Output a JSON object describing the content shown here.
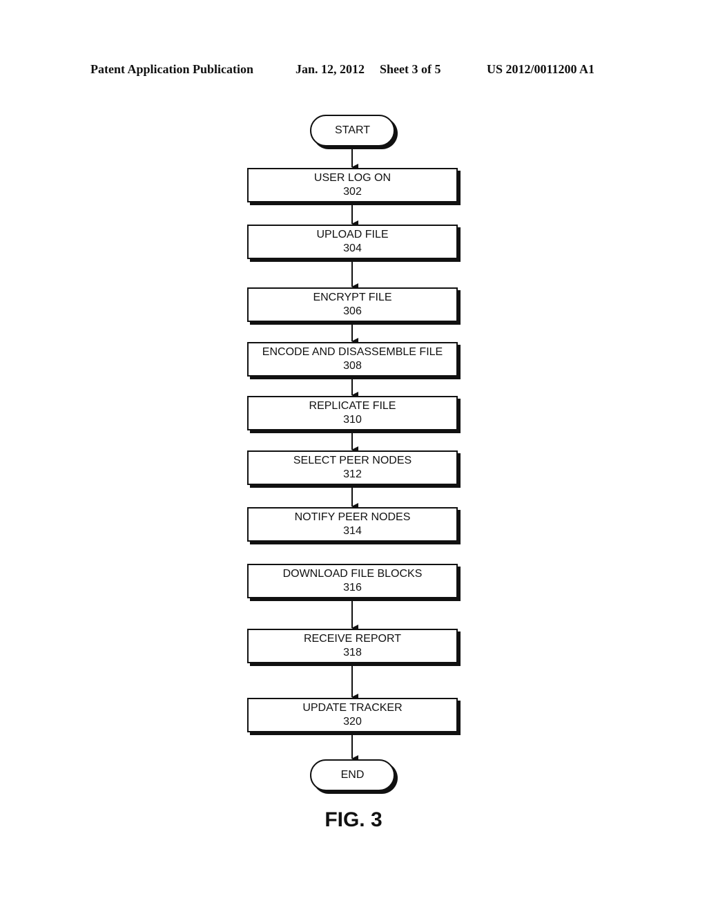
{
  "header": {
    "publication": "Patent Application Publication",
    "date": "Jan. 12, 2012",
    "sheet": "Sheet 3 of 5",
    "number": "US 2012/0011200 A1"
  },
  "flowchart": {
    "start": "START",
    "end": "END",
    "steps": [
      {
        "label": "USER LOG ON",
        "ref": "302"
      },
      {
        "label": "UPLOAD FILE",
        "ref": "304"
      },
      {
        "label": "ENCRYPT FILE",
        "ref": "306"
      },
      {
        "label": "ENCODE AND DISASSEMBLE FILE",
        "ref": "308"
      },
      {
        "label": "REPLICATE FILE",
        "ref": "310"
      },
      {
        "label": "SELECT PEER NODES",
        "ref": "312"
      },
      {
        "label": "NOTIFY PEER NODES",
        "ref": "314"
      },
      {
        "label": "DOWNLOAD FILE BLOCKS",
        "ref": "316"
      },
      {
        "label": "RECEIVE REPORT",
        "ref": "318"
      },
      {
        "label": "UPDATE TRACKER",
        "ref": "320"
      }
    ],
    "connections": [
      {
        "from": "START",
        "to": "302"
      },
      {
        "from": "302",
        "to": "304"
      },
      {
        "from": "304",
        "to": "306"
      },
      {
        "from": "306",
        "to": "308"
      },
      {
        "from": "308",
        "to": "310"
      },
      {
        "from": "310",
        "to": "312"
      },
      {
        "from": "312",
        "to": "314"
      },
      {
        "from": "316",
        "to": "318"
      },
      {
        "from": "318",
        "to": "320"
      },
      {
        "from": "320",
        "to": "END"
      }
    ]
  },
  "figure_label": "FIG. 3"
}
